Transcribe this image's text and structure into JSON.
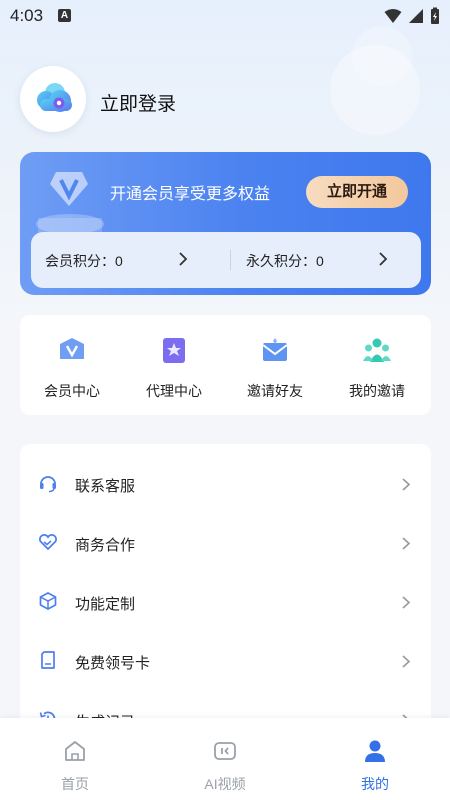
{
  "status_bar": {
    "time": "4:03",
    "notification_badge": "A"
  },
  "profile": {
    "login_label": "立即登录"
  },
  "vip_card": {
    "title": "开通会员享受更多权益",
    "button_label": "立即开通",
    "member_points_label": "会员积分：0",
    "permanent_points_label": "永久积分：0"
  },
  "quick_actions": [
    {
      "label": "会员中心",
      "icon": "member-center-icon"
    },
    {
      "label": "代理中心",
      "icon": "agent-center-icon"
    },
    {
      "label": "邀请好友",
      "icon": "invite-friends-icon"
    },
    {
      "label": "我的邀请",
      "icon": "my-invitations-icon"
    }
  ],
  "menu_items": [
    {
      "label": "联系客服",
      "icon": "headset-icon"
    },
    {
      "label": "商务合作",
      "icon": "handshake-heart-icon"
    },
    {
      "label": "功能定制",
      "icon": "cube-icon"
    },
    {
      "label": "免费领号卡",
      "icon": "sim-card-icon"
    },
    {
      "label": "生成记录",
      "icon": "history-icon"
    }
  ],
  "bottom_nav": {
    "active": "我的",
    "items": [
      {
        "label": "首页",
        "icon": "home-icon"
      },
      {
        "label": "AI视频",
        "icon": "ai-video-icon"
      },
      {
        "label": "我的",
        "icon": "profile-icon"
      }
    ]
  },
  "colors": {
    "accent_blue": "#3f78ee",
    "vip_button_gold": "#f3c79b",
    "active_nav": "#3470e8",
    "inactive_nav": "#9aa0aa"
  }
}
